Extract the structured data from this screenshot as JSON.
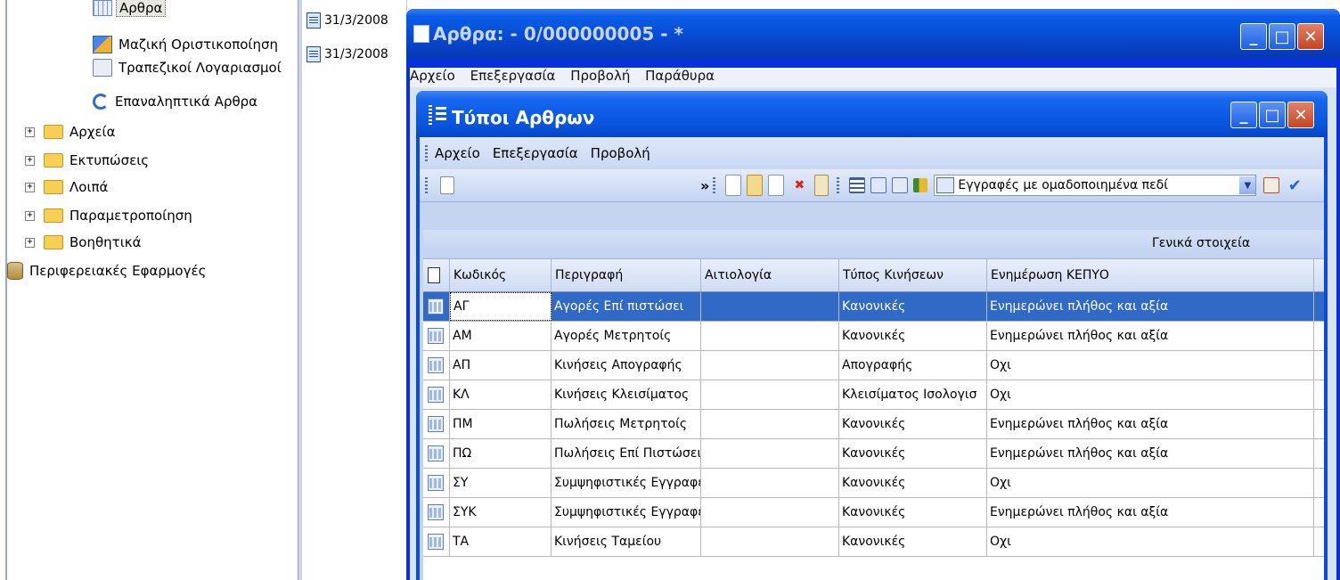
{
  "tree": {
    "items": [
      {
        "label": "Αρθρα",
        "icon": "grid-icon",
        "expander": ""
      },
      {
        "label": "Μαζική Οριστικοποίηση",
        "icon": "finalize-icon",
        "expander": ""
      },
      {
        "label": "Τραπεζικοί Λογαριασμοί",
        "icon": "bank-accounts-icon",
        "expander": ""
      },
      {
        "label": "Επαναληπτικά Αρθρα",
        "icon": "repeat-icon",
        "expander": ""
      },
      {
        "label": "Αρχεία",
        "icon": "folder-icon",
        "expander": "+"
      },
      {
        "label": "Εκτυπώσεις",
        "icon": "folder-icon",
        "expander": "+"
      },
      {
        "label": "Λοιπά",
        "icon": "folder-icon",
        "expander": "+"
      },
      {
        "label": "Παραμετροποίηση",
        "icon": "folder-icon",
        "expander": "+"
      },
      {
        "label": "Βοηθητικά",
        "icon": "folder-icon",
        "expander": "+"
      },
      {
        "label": "Περιφερειακές Εφαρμογές",
        "icon": "database-icon",
        "expander": ""
      }
    ]
  },
  "dates": [
    "31/3/2008",
    "31/3/2008"
  ],
  "outer_window": {
    "title": "Αρθρα:  - 0/000000005 - *",
    "menu": [
      "Αρχείο",
      "Επεξεργασία",
      "Προβολή",
      "Παράθυρα"
    ]
  },
  "inner_window": {
    "title": "Τύποι Αρθρων",
    "menu": [
      "Αρχείο",
      "Επεξεργασία",
      "Προβολή"
    ],
    "toolbar": {
      "overflow": "»",
      "view_combo_value": "Εγγραφές με ομαδοποιημένα πεδί"
    },
    "grid": {
      "band_header": "Γενικά στοιχεία",
      "columns": [
        "Κωδικός",
        "Περιγραφή",
        "Αιτιολογία",
        "Τύπος Κινήσεων",
        "Ενημέρωση ΚΕΠΥΟ"
      ],
      "rows": [
        [
          "ΑΓ",
          "Αγορές Επί πιστώσει",
          "",
          "Κανονικές",
          "Ενημερώνει πλήθος και αξία"
        ],
        [
          "ΑΜ",
          "Αγορές Μετρητοίς",
          "",
          "Κανονικές",
          "Ενημερώνει πλήθος και αξία"
        ],
        [
          "ΑΠ",
          "Κινήσεις Απογραφής",
          "",
          "Απογραφής",
          "Οχι"
        ],
        [
          "ΚΛ",
          "Κινήσεις Κλεισίματος",
          "",
          "Κλεισίματος Ισολογισ",
          "Οχι"
        ],
        [
          "ΠΜ",
          "Πωλήσεις Μετρητοίς",
          "",
          "Κανονικές",
          "Ενημερώνει πλήθος και αξία"
        ],
        [
          "ΠΩ",
          "Πωλήσεις Επί Πιστώσει",
          "",
          "Κανονικές",
          "Ενημερώνει πλήθος και αξία"
        ],
        [
          "ΣΥ",
          "Συμψηφιστικές Εγγραφές",
          "",
          "Κανονικές",
          "Οχι"
        ],
        [
          "ΣΥΚ",
          "Συμψηφιστικές Εγγραφές",
          "",
          "Κανονικές",
          "Ενημερώνει πλήθος και αξία"
        ],
        [
          "ΤΑ",
          "Κινήσεις Ταμείου",
          "",
          "Κανονικές",
          "Οχι"
        ]
      ]
    }
  },
  "colors": {
    "title_bar": "#0a55e0",
    "selection": "#3169c6",
    "close_button": "#c4451f"
  }
}
